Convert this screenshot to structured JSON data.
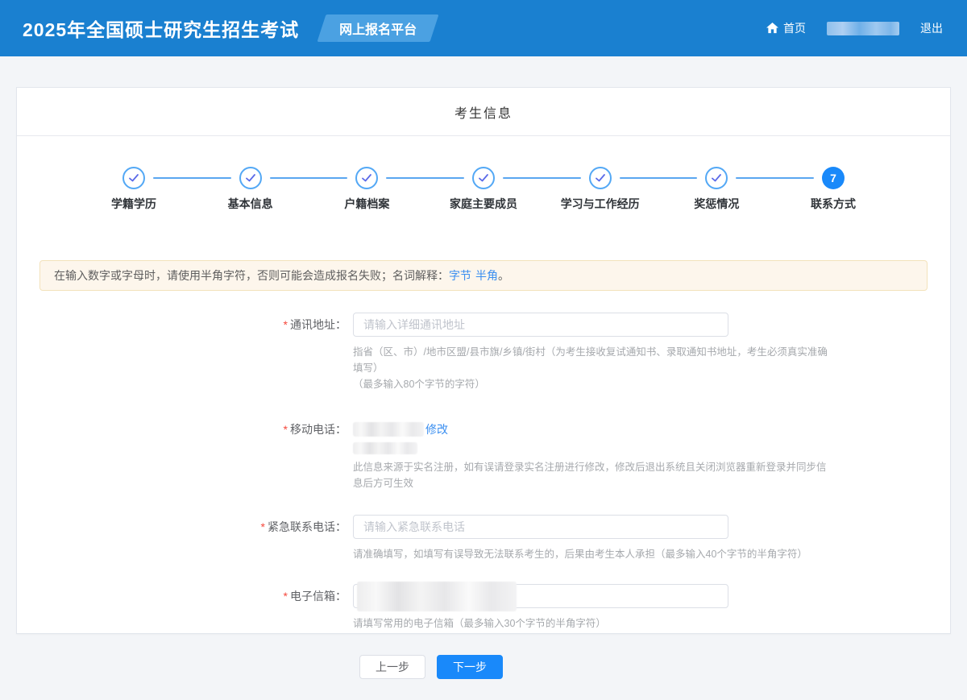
{
  "header": {
    "title": "2025年全国硕士研究生招生考试",
    "badge": "网上报名平台",
    "nav": {
      "home": "首页",
      "logout": "退出"
    }
  },
  "panel": {
    "title": "考生信息"
  },
  "stepper": {
    "steps": [
      {
        "label": "学籍学历",
        "status": "done"
      },
      {
        "label": "基本信息",
        "status": "done"
      },
      {
        "label": "户籍档案",
        "status": "done"
      },
      {
        "label": "家庭主要成员",
        "status": "done"
      },
      {
        "label": "学习与工作经历",
        "status": "done"
      },
      {
        "label": "奖惩情况",
        "status": "done"
      },
      {
        "label": "联系方式",
        "status": "active",
        "number": "7"
      }
    ]
  },
  "alert": {
    "text": "在输入数字或字母时，请使用半角字符，否则可能会造成报名失败；名词解释：",
    "link_byte": "字节",
    "link_halfwidth": "半角",
    "suffix": "。"
  },
  "form": {
    "address": {
      "label": "通讯地址：",
      "placeholder": "请输入详细通讯地址",
      "help1": "指省（区、市）/地市区盟/县市旗/乡镇/街村（为考生接收复试通知书、录取通知书地址，考生必须真实准确填写）",
      "help2": "（最多输入80个字节的字符）"
    },
    "mobile": {
      "label": "移动电话：",
      "modify_link": "修改",
      "help": "此信息来源于实名注册，如有误请登录实名注册进行修改，修改后退出系统且关闭浏览器重新登录并同步信息后方可生效"
    },
    "emergency": {
      "label": "紧急联系电话：",
      "placeholder": "请输入紧急联系电话",
      "help": "请准确填写，如填写有误导致无法联系考生的，后果由考生本人承担（最多输入40个字节的半角字符）"
    },
    "email": {
      "label": "电子信箱：",
      "help": "请填写常用的电子信箱（最多输入30个字节的半角字符）"
    }
  },
  "buttons": {
    "prev": "上一步",
    "next": "下一步"
  },
  "colors": {
    "header_bg": "#1a80d0",
    "badge_bg": "#4ba1e2",
    "primary": "#1989fa",
    "step_line": "#5aa6f0",
    "alert_bg": "#fdf6ec",
    "alert_border": "#f3e2bb",
    "link": "#3a8ef0",
    "required_mark": "#f5483c"
  }
}
